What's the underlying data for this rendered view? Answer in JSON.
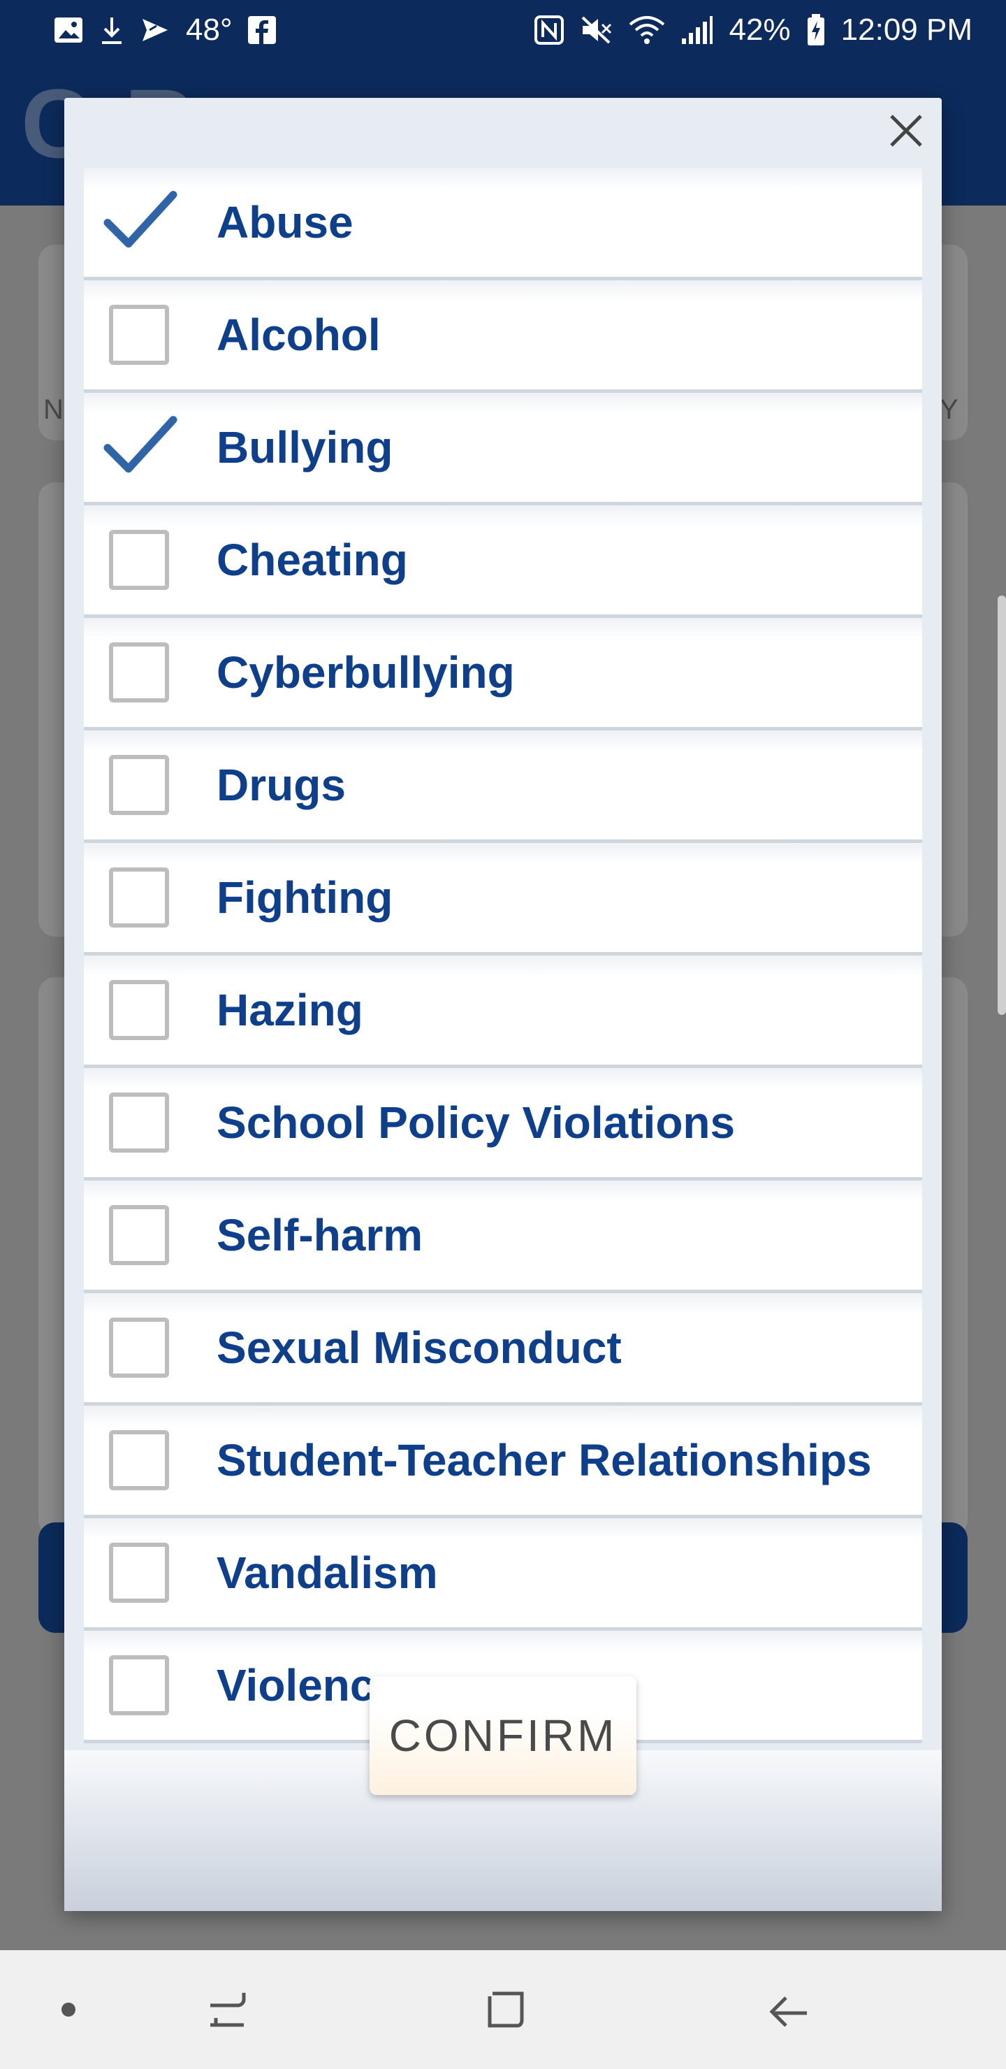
{
  "status_bar": {
    "temperature": "48°",
    "battery": "42%",
    "time": "12:09 PM",
    "left_icons": [
      "image-icon",
      "download-icon",
      "send-icon",
      "facebook-icon"
    ],
    "right_icons": [
      "nfc-icon",
      "mute-icon",
      "wifi-icon",
      "signal-icon",
      "battery-charging-icon"
    ]
  },
  "background_app": {
    "title_fragment": "C      R",
    "left_letter": "N",
    "right_letter": "Y"
  },
  "modal": {
    "close_icon": "close-icon",
    "items": [
      {
        "label": "Abuse",
        "checked": true
      },
      {
        "label": "Alcohol",
        "checked": false
      },
      {
        "label": "Bullying",
        "checked": true
      },
      {
        "label": "Cheating",
        "checked": false
      },
      {
        "label": "Cyberbullying",
        "checked": false
      },
      {
        "label": "Drugs",
        "checked": false
      },
      {
        "label": "Fighting",
        "checked": false
      },
      {
        "label": "Hazing",
        "checked": false
      },
      {
        "label": "School Policy Violations",
        "checked": false
      },
      {
        "label": "Self-harm",
        "checked": false
      },
      {
        "label": "Sexual Misconduct",
        "checked": false
      },
      {
        "label": "Student-Teacher Relationships",
        "checked": false
      },
      {
        "label": "Vandalism",
        "checked": false
      },
      {
        "label": "Violence",
        "checked": false
      }
    ],
    "confirm_label": "CONFIRM"
  },
  "colors": {
    "brand_navy": "#0c2a5b",
    "label_blue": "#0d3f8c",
    "check_blue": "#2f64a8"
  },
  "nav_bar": {
    "icons": [
      "dot-icon",
      "recent-apps-icon",
      "home-icon",
      "back-icon"
    ]
  }
}
